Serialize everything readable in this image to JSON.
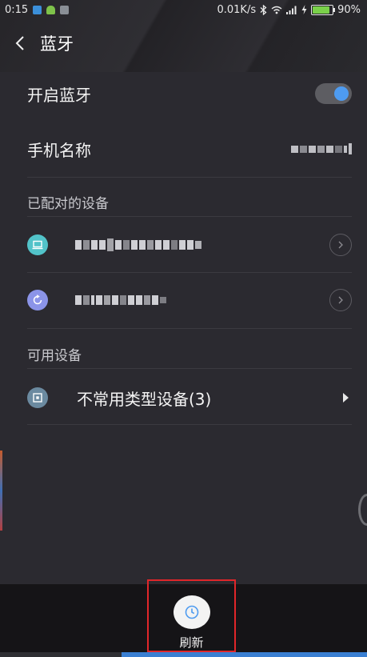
{
  "status_bar": {
    "time": "0:15",
    "net_speed": "0.01K/s",
    "battery": "90%",
    "icons": [
      "notify-blue-icon",
      "android-icon",
      "notify-gray-icon",
      "bluetooth-icon",
      "wifi-icon",
      "signal-icon",
      "charging-icon"
    ]
  },
  "header": {
    "title": "蓝牙"
  },
  "bluetooth_toggle": {
    "label": "开启蓝牙",
    "on": true,
    "accent": "#4e9bf0"
  },
  "device_name": {
    "label": "手机名称"
  },
  "paired_section": {
    "label": "已配对的设备",
    "devices": [
      {
        "icon": "laptop-icon",
        "icon_color": "#52c3c9"
      },
      {
        "icon": "sync-icon",
        "icon_color": "#8b94e8"
      }
    ]
  },
  "available_section": {
    "label": "可用设备",
    "uncommon": {
      "label": "不常用类型设备(3)",
      "icon": "device-square-icon",
      "icon_color": "#6b8aa0"
    }
  },
  "bottom": {
    "refresh_label": "刷新",
    "highlight_color": "#e0262a"
  }
}
